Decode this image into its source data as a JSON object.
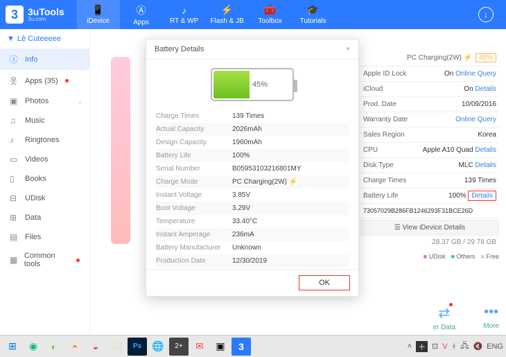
{
  "app": {
    "name": "3uTools",
    "site": "3u.com"
  },
  "topnav": [
    {
      "label": "iDevice",
      "active": true
    },
    {
      "label": "Apps"
    },
    {
      "label": "RT & WP"
    },
    {
      "label": "Flash & JB"
    },
    {
      "label": "Toolbox"
    },
    {
      "label": "Tutorials"
    }
  ],
  "sidebar": {
    "header": "Lệ Cuteeeee",
    "items": [
      {
        "label": "Info",
        "active": true
      },
      {
        "label": "Apps  (35)",
        "dot": true
      },
      {
        "label": "Photos",
        "chev": true
      },
      {
        "label": "Music"
      },
      {
        "label": "Ringtones"
      },
      {
        "label": "Videos"
      },
      {
        "label": "Books"
      },
      {
        "label": "UDisk"
      },
      {
        "label": "Data"
      },
      {
        "label": "Files"
      },
      {
        "label": "Common tools",
        "dot": true
      }
    ]
  },
  "details": {
    "header": {
      "label": "PC Charging(2W)",
      "pct": "45%"
    },
    "rows": [
      {
        "k": "Apple ID Lock",
        "v": "On",
        "vClass": "on-red",
        "link": "Online Query"
      },
      {
        "k": "iCloud",
        "v": "On",
        "link": "Details"
      },
      {
        "k": "Prod. Date",
        "v": "10/09/2016"
      },
      {
        "k": "Warranty Date",
        "link": "Online Query"
      },
      {
        "k": "Sales Region",
        "v": "Korea"
      },
      {
        "k": "CPU",
        "v": "Apple A10 Quad",
        "link": "Details"
      },
      {
        "k": "Disk Type",
        "v": "MLC",
        "link": "Details"
      },
      {
        "k": "Charge Times",
        "v": "139 Times"
      },
      {
        "k": "Battery Life",
        "v": "100%",
        "link": "Details",
        "hl": true
      }
    ],
    "serial": "73057029B286FB1246293F31BCE26D",
    "view": "View iDevice Details",
    "storage": "28.37 GB / 29.78 GB",
    "legend": {
      "u": "UDisk",
      "o": "Others",
      "f": "Free"
    },
    "actions": {
      "data": "er Data",
      "more": "More"
    }
  },
  "modal": {
    "title": "Battery Details",
    "pct": "45%",
    "rows": [
      {
        "k": "Charge Times",
        "v": "139 Times"
      },
      {
        "k": "Actual Capacity",
        "v": "2026mAh"
      },
      {
        "k": "Design Capacity",
        "v": "1960mAh"
      },
      {
        "k": "Battery Life",
        "v": "100%"
      },
      {
        "k": "Serial Number",
        "v": "B05953103216801MY"
      },
      {
        "k": "Charge Mode",
        "v": "PC Charging(2W)",
        "bolt": true
      },
      {
        "k": "Instant Voltage",
        "v": "3.85V"
      },
      {
        "k": "Boot Voltage",
        "v": "3.29V"
      },
      {
        "k": "Temperature",
        "v": "33.40°C"
      },
      {
        "k": "Instant Amperage",
        "v": "236mA"
      },
      {
        "k": "Battery Manufacturer",
        "v": "Unknown"
      },
      {
        "k": "Production Date",
        "v": "12/30/2019"
      }
    ],
    "ok": "OK"
  },
  "taskbar": {
    "lang": "ENG"
  }
}
